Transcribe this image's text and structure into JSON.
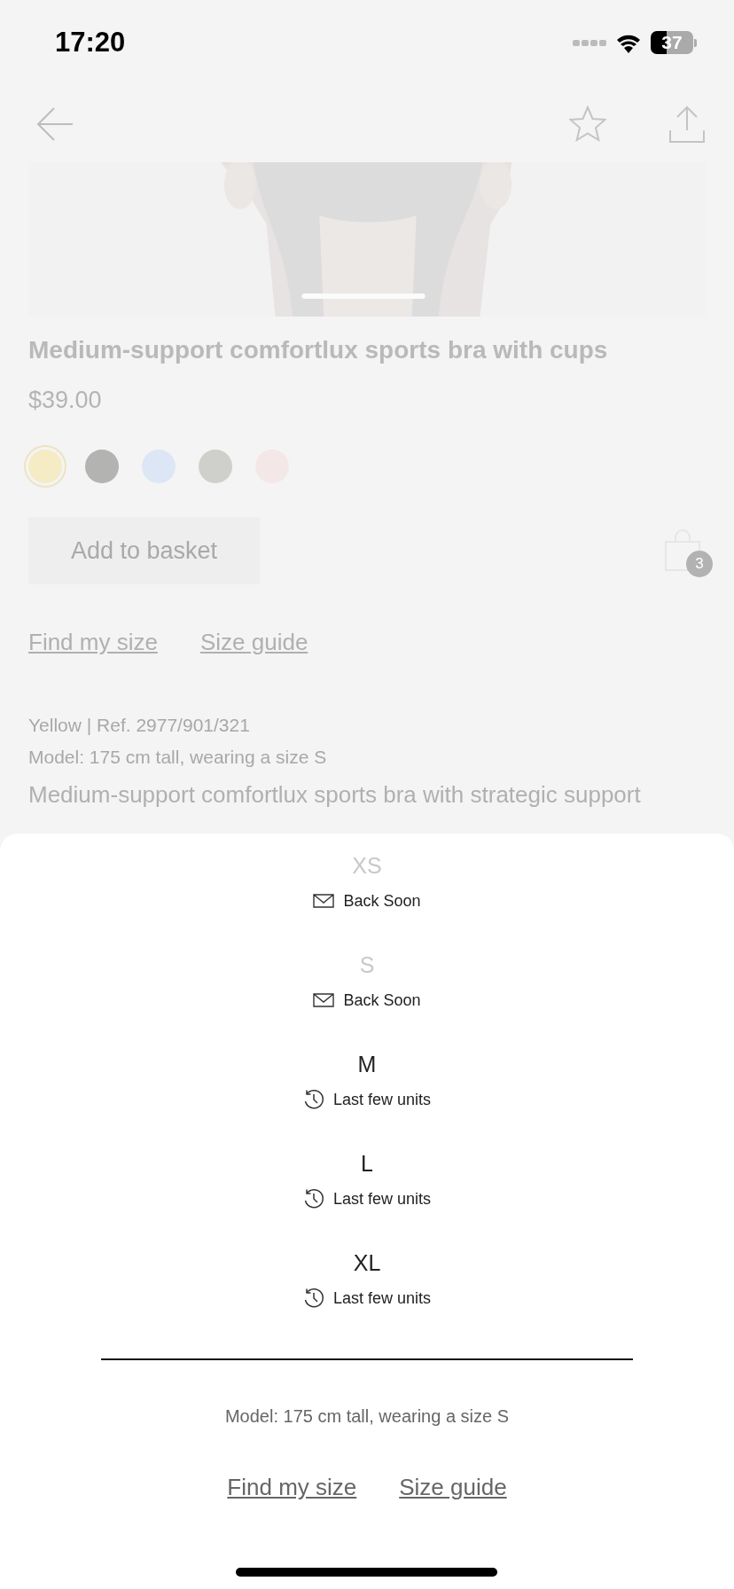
{
  "status_bar": {
    "time": "17:20",
    "battery": "37"
  },
  "product": {
    "title": "Medium-support comfortlux sports bra with cups",
    "price": "$39.00",
    "swatches": [
      {
        "color": "#f5ebc4",
        "selected": true
      },
      {
        "color": "#b3b3b1",
        "selected": false
      },
      {
        "color": "#dde6f4",
        "selected": false
      },
      {
        "color": "#cfcfcb",
        "selected": false
      },
      {
        "color": "#f3e8e7",
        "selected": false
      }
    ],
    "add_button": "Add to basket",
    "basket_count": "3",
    "links": [
      "Find my size",
      "Size guide"
    ],
    "reference": "Yellow | Ref. 2977/901/321",
    "model": "Model: 175 cm tall, wearing a size S",
    "description": "Medium-support comfortlux sports bra with strategic support"
  },
  "size_sheet": {
    "sizes": [
      {
        "size": "XS",
        "available": false,
        "kind": "back_soon",
        "status": "Back Soon"
      },
      {
        "size": "S",
        "available": false,
        "kind": "back_soon",
        "status": "Back Soon"
      },
      {
        "size": "M",
        "available": true,
        "kind": "last_few",
        "status": "Last few units"
      },
      {
        "size": "L",
        "available": true,
        "kind": "last_few",
        "status": "Last few units"
      },
      {
        "size": "XL",
        "available": true,
        "kind": "last_few",
        "status": "Last few units"
      }
    ],
    "model": "Model: 175 cm tall, wearing a size S",
    "links": [
      "Find my size",
      "Size guide"
    ]
  }
}
